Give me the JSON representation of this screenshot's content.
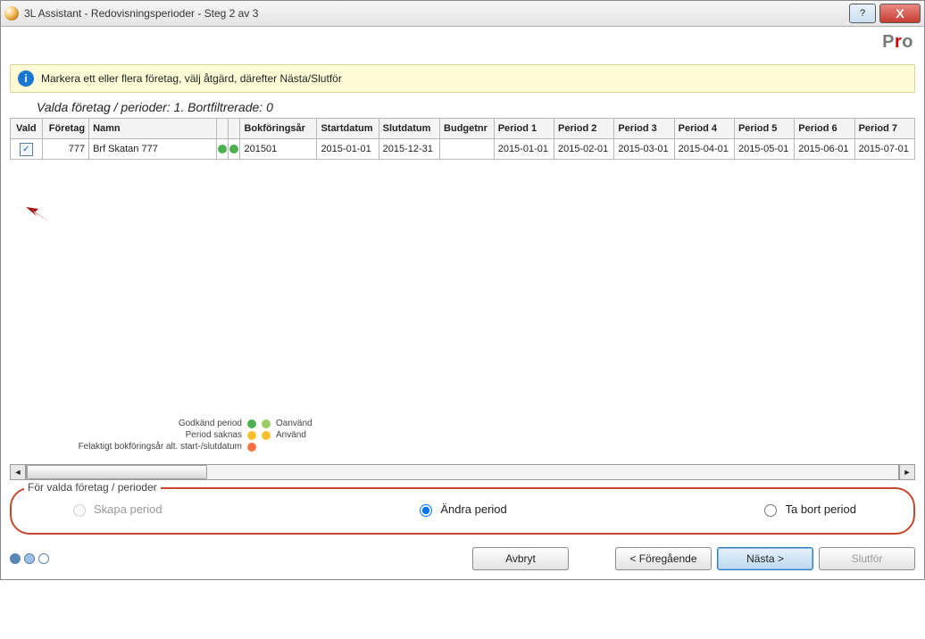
{
  "window": {
    "title": "3L Assistant - Redovisningsperioder - Steg 2 av 3",
    "help_tooltip": "?",
    "close_label": "X"
  },
  "brand": "Pro",
  "info_bar": {
    "text": "Markera ett eller flera företag, välj åtgärd, därefter Nästa/Slutför"
  },
  "summary": "Valda företag / perioder: 1. Bortfiltrerade: 0",
  "columns": {
    "vald": "Vald",
    "foretag": "Företag",
    "namn": "Namn",
    "bokforingsar": "Bokföringsår",
    "startdatum": "Startdatum",
    "slutdatum": "Slutdatum",
    "budgetnr": "Budgetnr",
    "period1": "Period 1",
    "period2": "Period 2",
    "period3": "Period 3",
    "period4": "Period 4",
    "period5": "Period 5",
    "period6": "Period 6",
    "period7": "Period 7"
  },
  "rows": [
    {
      "vald": true,
      "foretag": "777",
      "namn": "Brf Skatan 777",
      "bokforingsar": "201501",
      "startdatum": "2015-01-01",
      "slutdatum": "2015-12-31",
      "budgetnr": "",
      "period1": "2015-01-01",
      "period2": "2015-02-01",
      "period3": "2015-03-01",
      "period4": "2015-04-01",
      "period5": "2015-05-01",
      "period6": "2015-06-01",
      "period7": "2015-07-01"
    }
  ],
  "legend": {
    "l1_left": "Godkänd period",
    "l1_right": "Oanvänd",
    "l2_left": "Period saknas",
    "l2_right": "Använd",
    "l3_left": "Felaktigt bokföringsår alt. start-/slutdatum"
  },
  "group": {
    "label": "För valda företag / perioder",
    "opt_create": "Skapa period",
    "opt_change": "Ändra period",
    "opt_delete": "Ta bort period",
    "selected": "change"
  },
  "footer": {
    "cancel": "Avbryt",
    "back": "< Föregående",
    "next": "Nästa >",
    "finish": "Slutför"
  }
}
